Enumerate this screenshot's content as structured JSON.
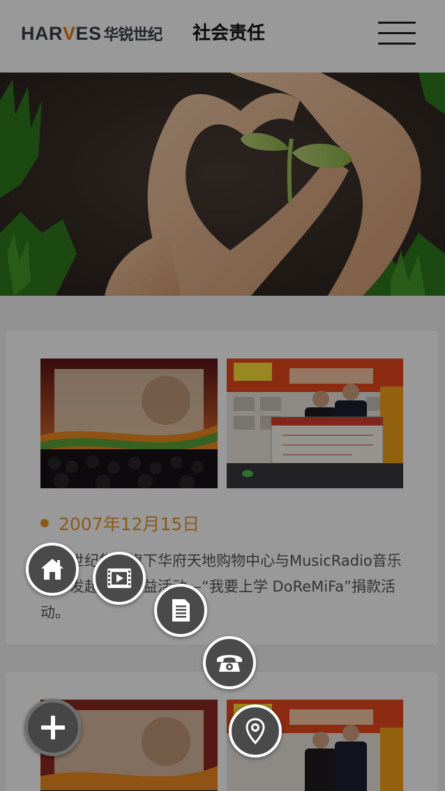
{
  "header": {
    "logo_latin_prefix": "HAR",
    "logo_latin_accent": "V",
    "logo_latin_suffix": "ES",
    "logo_cn": "华锐世纪",
    "title": "社会责任",
    "menu_icon": "hamburger-menu-icon"
  },
  "hero": {
    "image": "hands-heart-seedling-banner"
  },
  "news": [
    {
      "date": "2007年12月15日",
      "description": "华锐世纪集团旗下华府天地购物中心与MusicRadio音乐之声发起大型公益活动—“我要上学 DoReMiFa”捐款活动。",
      "photo_left": "concert-stage-photo",
      "photo_right": "donation-check-ceremony-photo"
    },
    {
      "photo_left": "concert-stage-photo",
      "photo_right": "donation-check-ceremony-photo"
    }
  ],
  "quick_nav": {
    "home_icon": "home-icon",
    "video_icon": "film-icon",
    "document_icon": "document-icon",
    "phone_icon": "phone-icon",
    "location_icon": "location-pin-icon",
    "toggle_icon": "plus-icon"
  },
  "colors": {
    "accent_orange": "#e8962e",
    "overlay": "rgba(0,0,0,0.40)",
    "fab_background": "#4a4a4a"
  }
}
